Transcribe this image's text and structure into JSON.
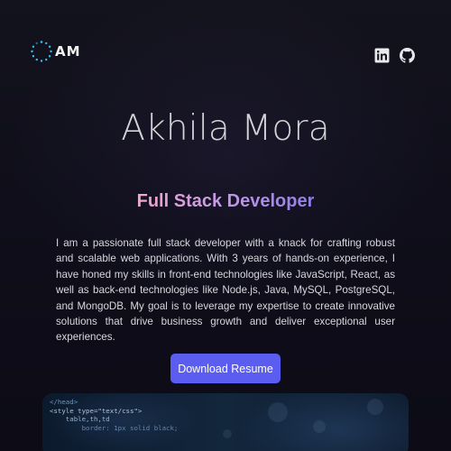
{
  "brand": {
    "logo_text": "AM"
  },
  "header": {
    "social_links": [
      {
        "icon": "linkedin-icon"
      },
      {
        "icon": "github-icon"
      }
    ]
  },
  "hero": {
    "name": "Akhila Mora",
    "role": "Full Stack Developer",
    "bio": "I am a passionate full stack developer with a knack for crafting robust and scalable web applications. With 3 years of hands-on experience, I have honed my skills in front-end technologies like JavaScript, React, as well as back-end technologies like Node.js, Java, MySQL, PostgreSQL, and MongoDB. My goal is to leverage my expertise to create innovative solutions that drive business growth and deliver exceptional user experiences.",
    "cta_label": "Download Resume"
  },
  "image": {
    "code_lines": [
      "</head>",
      "<style type=\"text/css\">",
      "    table,th,td",
      "        border: 1px solid black;"
    ]
  },
  "colors": {
    "background": "#0f0e1a",
    "accent_button": "#5b5cf0",
    "role_gradient_start": "#f1a7c6",
    "role_gradient_end": "#8f7de8"
  }
}
